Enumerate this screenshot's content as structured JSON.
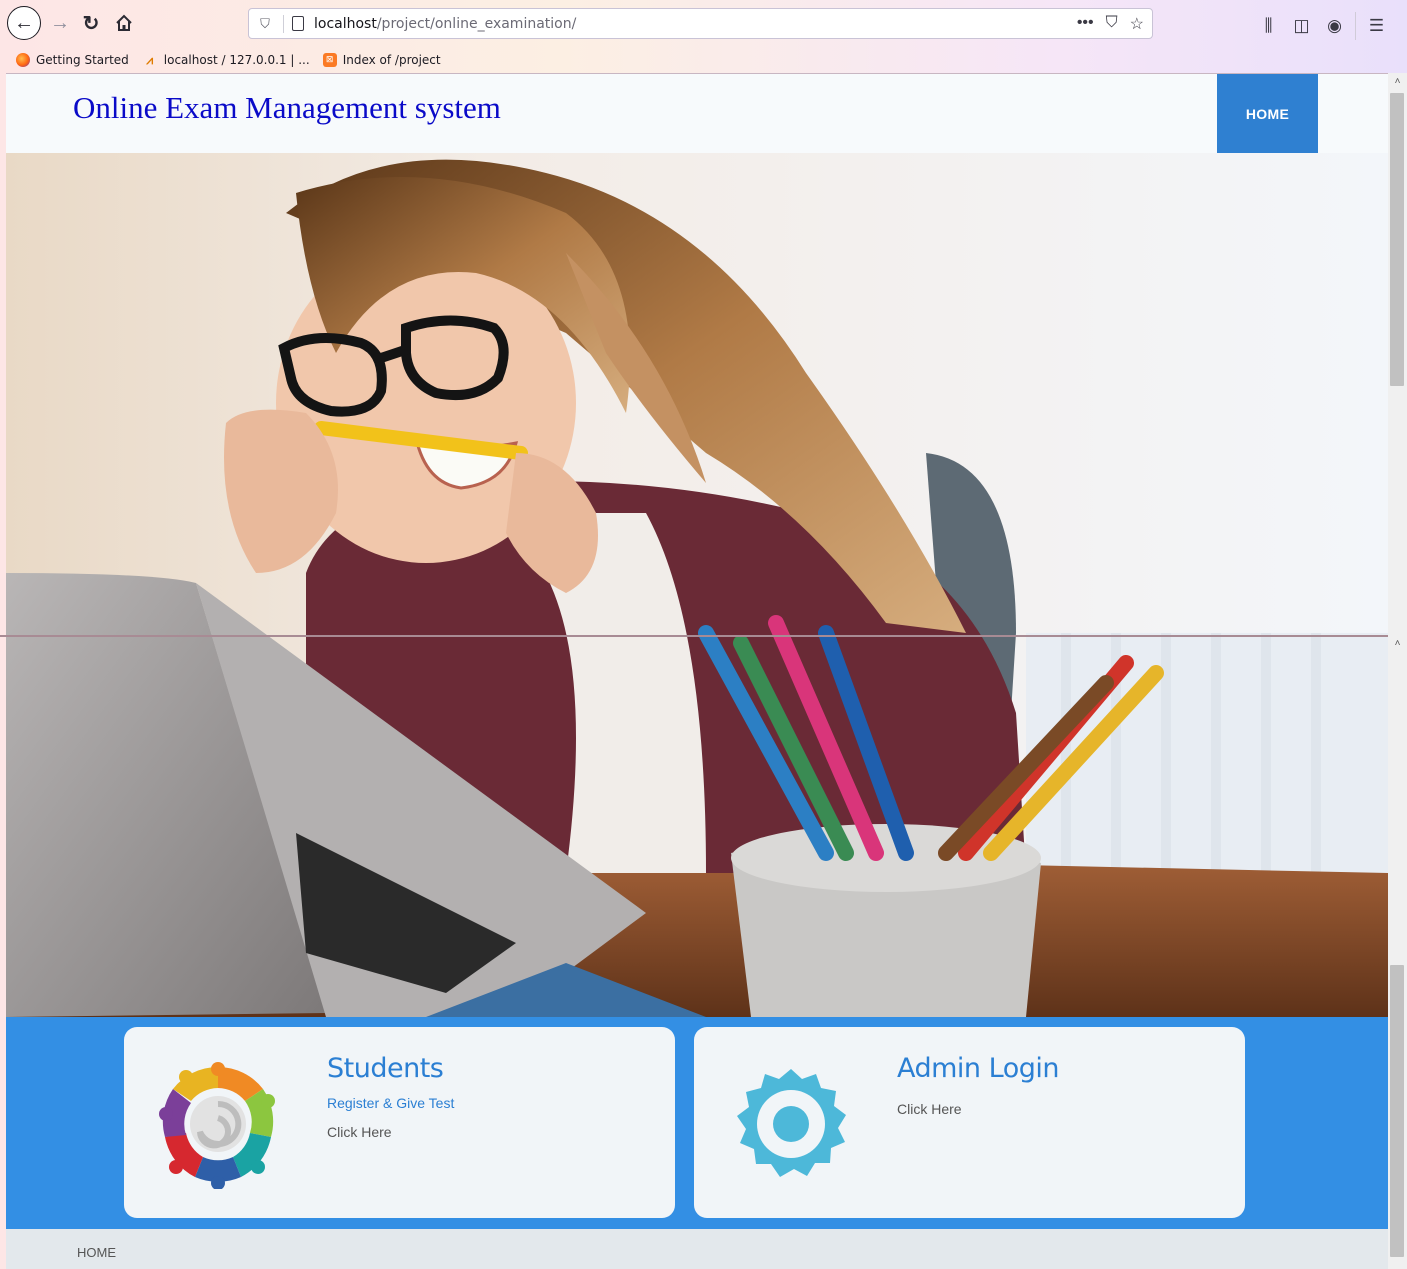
{
  "browser": {
    "url_host": "localhost",
    "url_path": "/project/online_examination/",
    "bookmarks": [
      {
        "label": "Getting Started",
        "icon": "firefox-icon"
      },
      {
        "label": "localhost / 127.0.0.1 | ...",
        "icon": "phpmyadmin-icon"
      },
      {
        "label": "Index of /project",
        "icon": "xampp-icon"
      }
    ]
  },
  "site": {
    "title": "Online Exam Management system",
    "nav_home": "HOME"
  },
  "hero": {
    "image": "woman-biting-pencil-at-laptop-photo"
  },
  "cards": {
    "students": {
      "title": "Students",
      "subtitle": "Register & Give Test",
      "link": "Click Here",
      "icon": "people-circle-icon"
    },
    "admin": {
      "title": "Admin Login",
      "link": "Click Here",
      "icon": "gear-icon"
    }
  },
  "footer": {
    "home": "HOME"
  },
  "colors": {
    "title": "#0a0ac8",
    "nav_accent": "#2f80d1",
    "band": "#338fe4",
    "card_text": "#2b7fd3"
  }
}
